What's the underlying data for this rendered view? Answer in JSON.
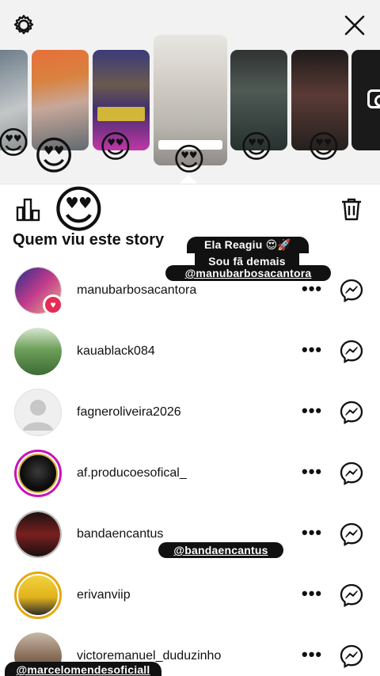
{
  "header": {
    "settings_icon": "gear-icon",
    "close_icon": "close-icon"
  },
  "stories": {
    "reactions": [
      "😍",
      "😍",
      "😍",
      "😍",
      "😍",
      "😍"
    ],
    "camera_icon": "camera-icon"
  },
  "toolbar": {
    "insights_icon": "bar-chart-icon",
    "delete_icon": "trash-icon",
    "big_reaction": "😍"
  },
  "viewers_title": "Quem viu este story",
  "overlays": {
    "line1": "Ela Reagiu 😍🚀",
    "line2": "Sou fã demais",
    "tag1": "@manubarbosacantora",
    "tag2": "@bandaencantus",
    "tag3": "@marcelomendesoficiall"
  },
  "viewers": [
    {
      "username": "manubarbosacantora",
      "more": "•••"
    },
    {
      "username": "kauablack084",
      "more": "•••"
    },
    {
      "username": "fagneroliveira2026",
      "more": "•••"
    },
    {
      "username": "af.producoesofical_",
      "more": "•••"
    },
    {
      "username": "bandaencantus",
      "more": "•••"
    },
    {
      "username": "erivanviip",
      "more": "•••"
    },
    {
      "username": "victoremanuel_duduzinho",
      "more": "•••"
    }
  ],
  "colors": {
    "like_red": "#e52c55",
    "story_ring": "#c913b9"
  }
}
